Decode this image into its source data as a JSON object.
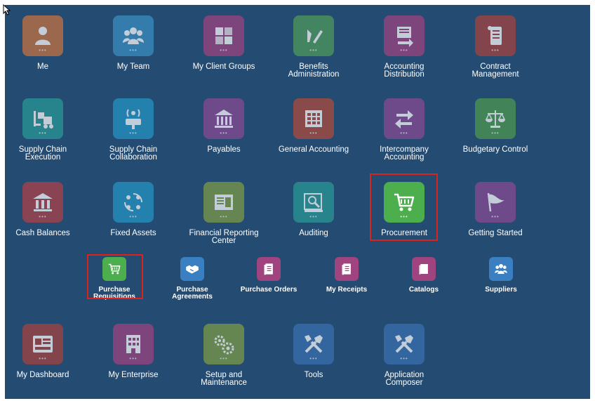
{
  "row1": [
    {
      "name": "me",
      "label": "Me",
      "color": "#c9743f",
      "icon": "person-icon"
    },
    {
      "name": "my-team",
      "label": "My Team",
      "color": "#3a8fc2",
      "icon": "team-icon"
    },
    {
      "name": "my-client-groups",
      "label": "My Client Groups",
      "color": "#a0447f",
      "icon": "grid-icon"
    },
    {
      "name": "benefits-administration",
      "label": "Benefits\nAdministration",
      "color": "#4f9c5a",
      "icon": "pen-icon"
    },
    {
      "name": "accounting-distribution",
      "label": "Accounting\nDistribution",
      "color": "#a0447f",
      "icon": "ledger-arrow-icon"
    },
    {
      "name": "contract-management",
      "label": "Contract\nManagement",
      "color": "#a8443d",
      "icon": "scroll-icon"
    }
  ],
  "row2": [
    {
      "name": "supply-chain-execution",
      "label": "Supply Chain\nExecution",
      "color": "#2a9b96",
      "icon": "forklift-icon"
    },
    {
      "name": "supply-chain-collaboration",
      "label": "Supply Chain\nCollaboration",
      "color": "#2596c4",
      "icon": "broadcast-icon"
    },
    {
      "name": "payables",
      "label": "Payables",
      "color": "#8b4a94",
      "icon": "bank-building-icon"
    },
    {
      "name": "general-accounting",
      "label": "General Accounting",
      "color": "#b04a3a",
      "icon": "spreadsheet-icon"
    },
    {
      "name": "intercompany-accounting",
      "label": "Intercompany\nAccounting",
      "color": "#8b4a94",
      "icon": "swap-arrows-icon"
    },
    {
      "name": "budgetary-control",
      "label": "Budgetary Control",
      "color": "#4e9a4f",
      "icon": "scales-icon"
    }
  ],
  "row3": [
    {
      "name": "cash-balances",
      "label": "Cash Balances",
      "color": "#b04046",
      "icon": "bank-icon"
    },
    {
      "name": "fixed-assets",
      "label": "Fixed Assets",
      "color": "#2596c4",
      "icon": "cycle-icon"
    },
    {
      "name": "financial-reporting-center",
      "label": "Financial Reporting\nCenter",
      "color": "#7e9c45",
      "icon": "report-icon"
    },
    {
      "name": "auditing",
      "label": "Auditing",
      "color": "#2a9b96",
      "icon": "audit-icon"
    },
    {
      "name": "procurement",
      "label": "Procurement",
      "color": "#4cae4c",
      "icon": "cart-icon"
    },
    {
      "name": "getting-started",
      "label": "Getting Started",
      "color": "#8b4a94",
      "icon": "flag-icon"
    }
  ],
  "subrow": [
    {
      "name": "purchase-requisitions",
      "label": "Purchase\nRequisitions",
      "color": "#4cae4c",
      "icon": "cart-icon"
    },
    {
      "name": "purchase-agreements",
      "label": "Purchase\nAgreements",
      "color": "#3a7fc2",
      "icon": "handshake-icon"
    },
    {
      "name": "purchase-orders",
      "label": "Purchase Orders",
      "color": "#a0447f",
      "icon": "document-icon"
    },
    {
      "name": "my-receipts",
      "label": "My Receipts",
      "color": "#a0447f",
      "icon": "document-icon"
    },
    {
      "name": "catalogs",
      "label": "Catalogs",
      "color": "#a0447f",
      "icon": "book-icon"
    },
    {
      "name": "suppliers",
      "label": "Suppliers",
      "color": "#3a7fc2",
      "icon": "team-icon"
    }
  ],
  "row4": [
    {
      "name": "my-dashboard",
      "label": "My Dashboard",
      "color": "#a8443d",
      "icon": "dashboard-icon"
    },
    {
      "name": "my-enterprise",
      "label": "My Enterprise",
      "color": "#a0447f",
      "icon": "building-icon"
    },
    {
      "name": "setup-and-maintenance",
      "label": "Setup and\nMaintenance",
      "color": "#7e9c45",
      "icon": "gears-icon"
    },
    {
      "name": "tools",
      "label": "Tools",
      "color": "#3a6fb0",
      "icon": "tools-icon"
    },
    {
      "name": "application-composer",
      "label": "Application\nComposer",
      "color": "#3a6fb0",
      "icon": "tools-icon"
    }
  ],
  "dots": "•••"
}
